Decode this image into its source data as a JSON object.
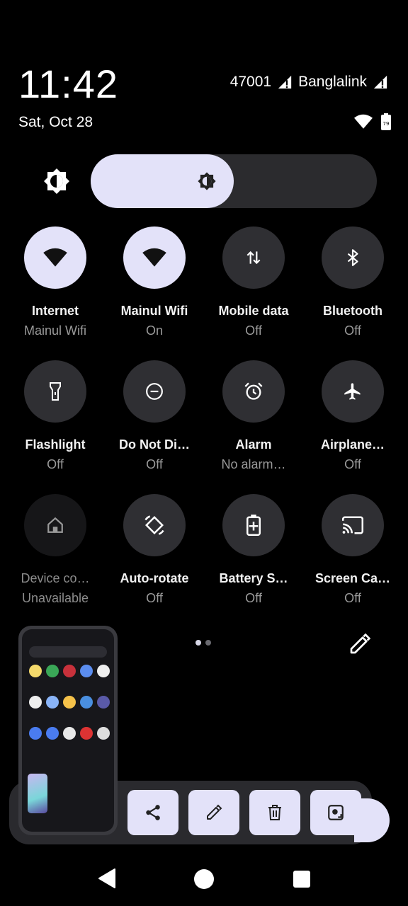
{
  "status": {
    "time": "11:42",
    "date": "Sat, Oct 28",
    "carriers": [
      "47001",
      "Banglalink"
    ],
    "battery_level": "79"
  },
  "brightness": {
    "level_fraction": 0.5
  },
  "tiles": [
    {
      "label": "Internet",
      "sub": "Mainul Wifi",
      "icon": "wifi-icon",
      "state": "on"
    },
    {
      "label": "Mainul Wifi",
      "sub": "On",
      "icon": "wifi-icon",
      "state": "on"
    },
    {
      "label": "Mobile data",
      "sub": "Off",
      "icon": "mobile-data-icon",
      "state": "off"
    },
    {
      "label": "Bluetooth",
      "sub": "Off",
      "icon": "bluetooth-icon",
      "state": "off"
    },
    {
      "label": "Flashlight",
      "sub": "Off",
      "icon": "flashlight-icon",
      "state": "off"
    },
    {
      "label": "Do Not Di…",
      "sub": "Off",
      "icon": "do-not-disturb-icon",
      "state": "off"
    },
    {
      "label": "Alarm",
      "sub": "No alarm…",
      "icon": "alarm-icon",
      "state": "off"
    },
    {
      "label": "Airplane…",
      "sub": "Off",
      "icon": "airplane-icon",
      "state": "off"
    },
    {
      "label": "Device co…",
      "sub": "Unavailable",
      "icon": "home-icon",
      "state": "unavailable"
    },
    {
      "label": "Auto-rotate",
      "sub": "Off",
      "icon": "auto-rotate-icon",
      "state": "off"
    },
    {
      "label": "Battery S…",
      "sub": "Off",
      "icon": "battery-saver-icon",
      "state": "off"
    },
    {
      "label": "Screen Ca…",
      "sub": "Off",
      "icon": "cast-icon",
      "state": "off"
    }
  ],
  "screenshot_actions": [
    "share-icon",
    "edit-icon",
    "delete-icon",
    "long-screenshot-icon"
  ],
  "colors": {
    "tile_on": "#e3e2f9",
    "tile_off": "#2f2f33",
    "background": "#000000"
  }
}
